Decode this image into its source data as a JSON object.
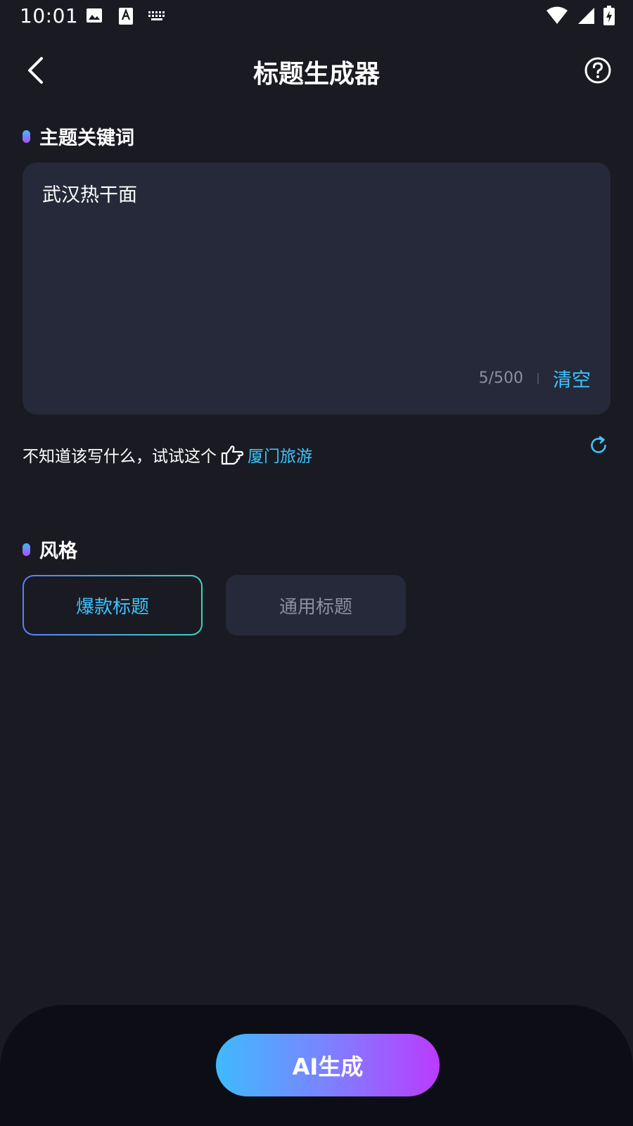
{
  "status_bar": {
    "time": "10:01",
    "left_icons": [
      "image-icon",
      "text-a-icon",
      "keyboard-icon"
    ],
    "right_icons": [
      "wifi-icon",
      "signal-icon",
      "battery-charging-icon"
    ]
  },
  "header": {
    "title": "标题生成器",
    "back_icon": "chevron-left-icon",
    "help_icon": "help-circle-icon"
  },
  "keyword_section": {
    "heading": "主题关键词",
    "input_value": "武汉热干面",
    "char_count": "5/500",
    "clear_label": "清空"
  },
  "suggestion": {
    "prompt": "不知道该写什么，试试这个",
    "hand_icon": "pointing-hand-icon",
    "example": "厦门旅游",
    "refresh_icon": "refresh-icon"
  },
  "style_section": {
    "heading": "风格",
    "options": [
      {
        "label": "爆款标题",
        "selected": true
      },
      {
        "label": "通用标题",
        "selected": false
      }
    ]
  },
  "generate_button": {
    "label": "AI生成"
  },
  "colors": {
    "background": "#1a1a22",
    "card": "#262939",
    "accent_cyan": "#3cc4ff",
    "gradient_start": "#3fbaff",
    "gradient_end": "#bb3bff",
    "muted_text": "#8d8f9e"
  }
}
